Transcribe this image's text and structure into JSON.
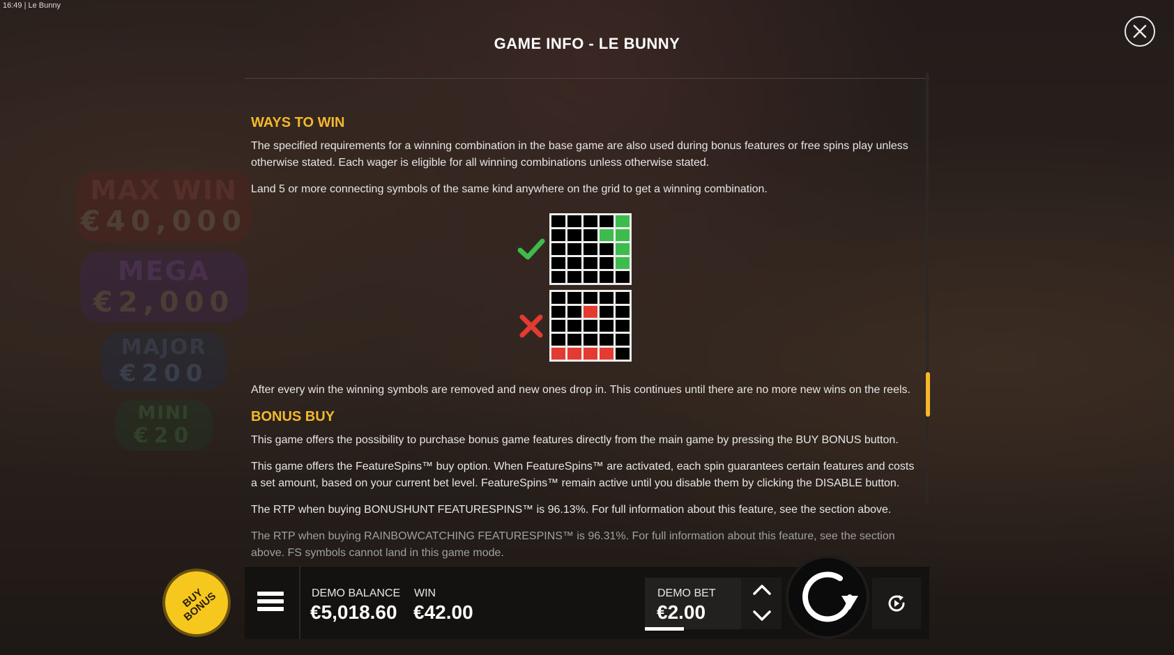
{
  "status_bar": {
    "time": "16:49",
    "separator": "|",
    "app": "Le Bunny"
  },
  "background_jackpots": [
    {
      "name": "MAX WIN",
      "value": "€40,000"
    },
    {
      "name": "MEGA",
      "value": "€2,000"
    },
    {
      "name": "MAJOR",
      "value": "€200"
    },
    {
      "name": "MINI",
      "value": "€20"
    }
  ],
  "dialog": {
    "title": "GAME INFO - LE BUNNY",
    "close_icon": "close-icon",
    "sections": {
      "ways_to_win": {
        "heading": "WAYS TO WIN",
        "p1": "The specified requirements for a winning combination in the base game are also used during bonus features or free spins play unless otherwise stated. Each wager is eligible for all winning combinations unless otherwise stated.",
        "p2": "Land 5 or more connecting symbols of the same kind anywhere on the grid to get a winning combination.",
        "p3": "After every win the winning symbols are removed and new ones drop in. This continues until there are no more new wins on the reels."
      },
      "bonus_buy": {
        "heading": "BONUS BUY",
        "p1": "This game offers the possibility to purchase bonus game features directly from the main game by pressing the BUY BONUS button.",
        "p2": "This game offers the FeatureSpins™ buy option. When FeatureSpins™ are activated, each spin guarantees certain features and costs a set amount, based on your current bet level. FeatureSpins™ remain active until you disable them by clicking the DISABLE button.",
        "p3": "The RTP when buying BONUSHUNT FEATURESPINS™ is 96.13%. For full information about this feature, see the section above.",
        "p4": "The RTP when buying RAINBOWCATCHING FEATURESPINS™ is 96.31%. For full information about this feature, see the section above. FS symbols cannot land in this game mode."
      }
    },
    "example_grids": {
      "valid": {
        "icon": "checkmark-icon",
        "color": "#3dbb4d",
        "cells": [
          [
            0,
            4
          ],
          [
            1,
            3
          ],
          [
            1,
            4
          ],
          [
            2,
            4
          ],
          [
            3,
            4
          ]
        ]
      },
      "invalid": {
        "icon": "cross-icon",
        "color": "#e33a32",
        "cells": [
          [
            1,
            2
          ],
          [
            4,
            0
          ],
          [
            4,
            1
          ],
          [
            4,
            2
          ],
          [
            4,
            3
          ]
        ]
      }
    },
    "accent_color": "#f3b92b"
  },
  "hud": {
    "menu_icon": "hamburger-menu-icon",
    "balance_label": "DEMO BALANCE",
    "balance_value": "€5,018.60",
    "win_label": "WIN",
    "win_value": "€42.00",
    "bet_label": "DEMO BET",
    "bet_value": "€2.00",
    "bet_up_icon": "chevron-up-icon",
    "bet_down_icon": "chevron-down-icon",
    "spin_icon": "spin-arrow-icon",
    "autoplay_icon": "autoplay-icon"
  },
  "buy_bonus": {
    "line1": "BUY",
    "line2": "BONUS"
  }
}
